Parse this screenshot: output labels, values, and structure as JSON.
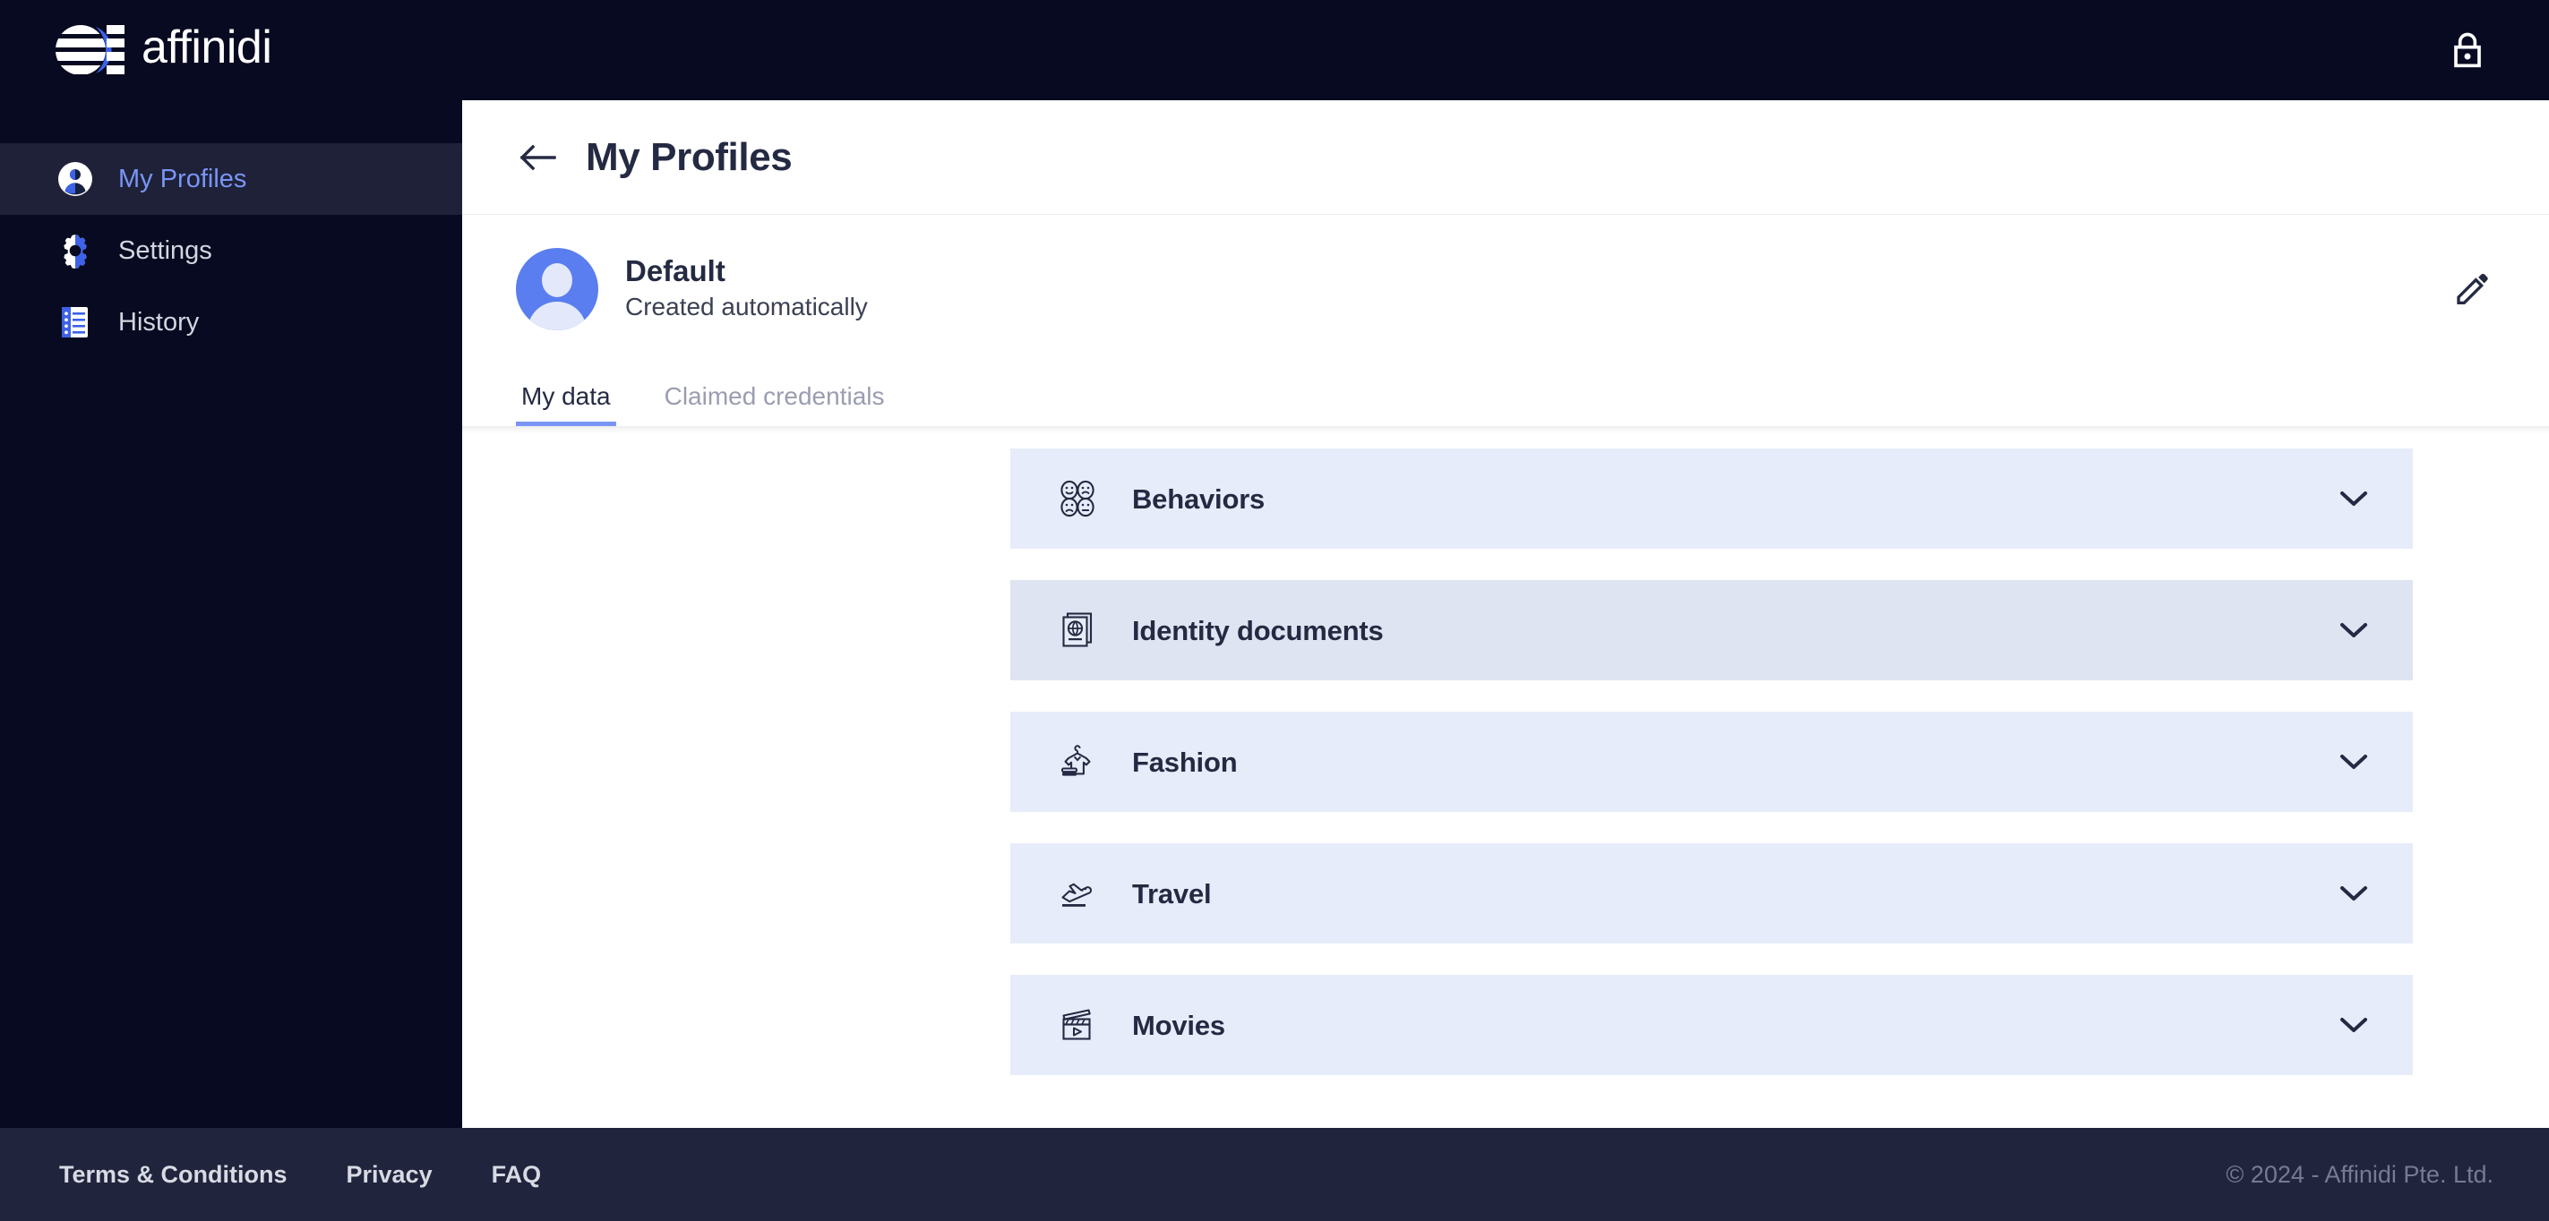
{
  "topbar": {
    "brand_name": "affinidi",
    "logo_icon": "affinidi-logo-icon",
    "lock_icon": "lock-icon"
  },
  "sidebar": {
    "items": [
      {
        "label": "My Profiles",
        "icon": "user-circle-icon",
        "active": true
      },
      {
        "label": "Settings",
        "icon": "gear-icon",
        "active": false
      },
      {
        "label": "History",
        "icon": "notebook-list-icon",
        "active": false
      }
    ]
  },
  "page": {
    "back_icon": "arrow-left-icon",
    "title": "My Profiles"
  },
  "profile": {
    "avatar_icon": "avatar-person-icon",
    "name": "Default",
    "subtitle": "Created automatically",
    "edit_icon": "pencil-edit-icon"
  },
  "tabs": [
    {
      "label": "My data",
      "active": true
    },
    {
      "label": "Claimed credentials",
      "active": false
    }
  ],
  "accordion": {
    "chevron_icon": "chevron-down-icon",
    "rows": [
      {
        "label": "Behaviors",
        "icon": "emoji-faces-icon",
        "expanded": false,
        "hovered": false
      },
      {
        "label": "Identity documents",
        "icon": "passport-globe-icon",
        "expanded": false,
        "hovered": true
      },
      {
        "label": "Fashion",
        "icon": "shirt-hanger-icon",
        "expanded": false,
        "hovered": false
      },
      {
        "label": "Travel",
        "icon": "airplane-takeoff-icon",
        "expanded": false,
        "hovered": false
      },
      {
        "label": "Movies",
        "icon": "clapperboard-icon",
        "expanded": false,
        "hovered": false
      }
    ]
  },
  "footer": {
    "links": [
      {
        "label": "Terms & Conditions"
      },
      {
        "label": "Privacy"
      },
      {
        "label": "FAQ"
      }
    ],
    "copyright": "© 2024 - Affinidi Pte. Ltd."
  },
  "colors": {
    "header_bg": "#070a20",
    "footer_bg": "#20243c",
    "accent_blue": "#3d62e8",
    "active_nav_text": "#7a95f5",
    "row_bg": "#e7ecfa",
    "row_bg_hover": "#dfe4f2",
    "ink": "#252a43"
  }
}
